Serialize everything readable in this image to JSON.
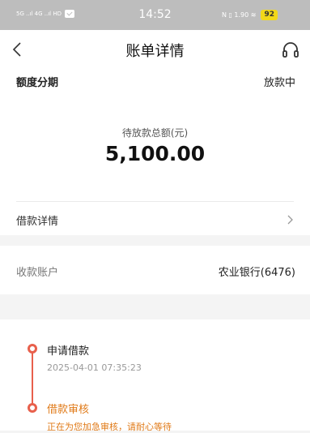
{
  "status_bar": {
    "left_text": "5G ..ıl 4G ..ıl HD",
    "time": "14:52",
    "right_text": "N ▯ 1.90 ≋",
    "battery": "92"
  },
  "nav": {
    "title": "账单详情"
  },
  "summary": {
    "type_label": "额度分期",
    "status": "放款中",
    "amount_label": "待放款总额(元)",
    "amount": "5,100.00",
    "loan_detail_label": "借款详情"
  },
  "account": {
    "label": "收款账户",
    "value": "农业银行(6476)"
  },
  "timeline": {
    "steps": [
      {
        "title": "申请借款",
        "time": "2025-04-01 07:35:23"
      },
      {
        "title": "借款审核",
        "desc": "正在为您加急审核，请耐心等待"
      }
    ]
  },
  "colors": {
    "accent_red": "#e8604c",
    "accent_orange": "#e07a18",
    "battery_yellow": "#f2d81a"
  }
}
